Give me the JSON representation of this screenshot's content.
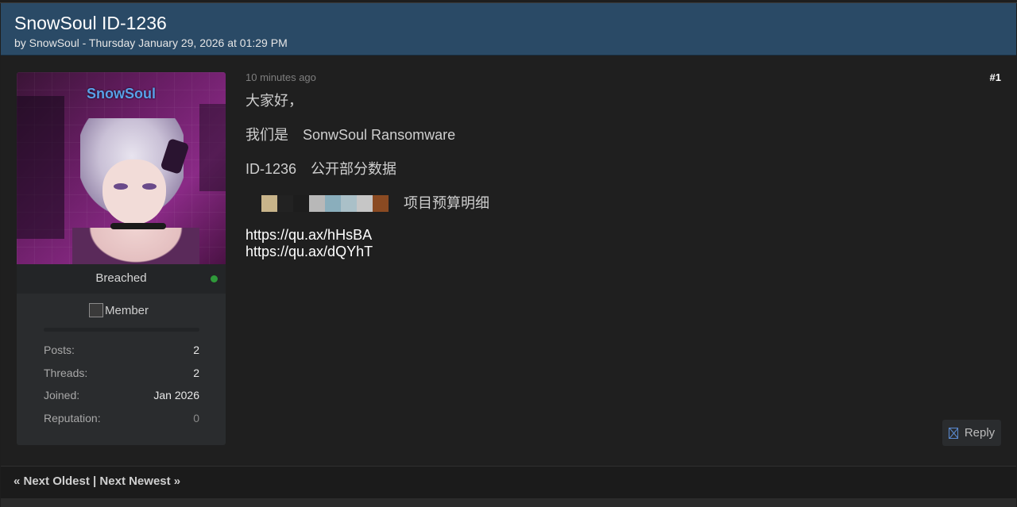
{
  "thread": {
    "title": "SnowSoul ID-1236",
    "byline": "by SnowSoul - Thursday January 29, 2026 at 01:29 PM"
  },
  "author": {
    "avatar_name": "SnowSoul",
    "usertitle": "Breached",
    "online_status_color": "#2f9a3a",
    "group_image_alt": "Member",
    "stats": [
      {
        "label": "Posts:",
        "value": "2"
      },
      {
        "label": "Threads:",
        "value": "2"
      },
      {
        "label": "Joined:",
        "value": "Jan 2026"
      },
      {
        "label": "Reputation:",
        "value": "0"
      }
    ]
  },
  "post": {
    "time": "10 minutes ago",
    "number": "#1",
    "lines": [
      "大家好，",
      "我们是　SonwSoul Ransomware",
      "ID-1236　公开部分数据"
    ],
    "blurred_label": "项目预算明细",
    "blur_colors": [
      "#1f1f1f",
      "#c8b48a",
      "#222222",
      "#1d1d1d",
      "#b8b8b8",
      "#8aaebc",
      "#aac0c8",
      "#c6c6c6",
      "#8a4a22"
    ],
    "links": [
      "https://qu.ax/hHsBA",
      "https://qu.ax/dQYhT"
    ]
  },
  "actions": {
    "reply_label": "Reply"
  },
  "nav": {
    "next_oldest": "« Next Oldest",
    "separator": "|",
    "next_newest": "Next Newest »"
  },
  "colors": {
    "header_bg": "#2a4a66",
    "page_bg": "#1e1e1e",
    "card_bg": "#2a2c2e",
    "avatar_name": "#5aa0e8"
  }
}
